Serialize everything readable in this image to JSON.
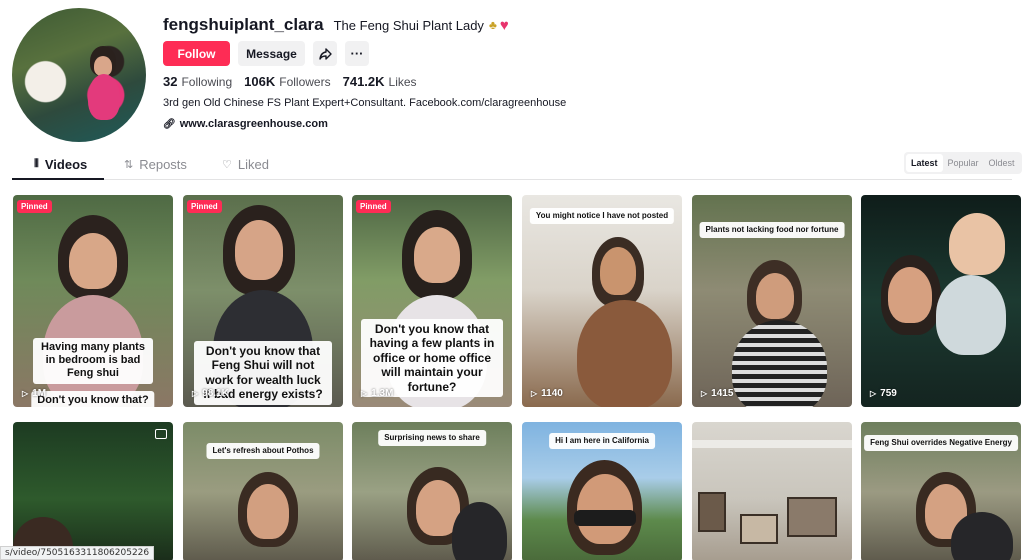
{
  "profile": {
    "username": "fengshuiplant_clara",
    "nickname": "The Feng Shui Plant Lady",
    "follow_label": "Follow",
    "message_label": "Message",
    "following_count": "32",
    "following_label": "Following",
    "followers_count": "106K",
    "followers_label": "Followers",
    "likes_count": "741.2K",
    "likes_label": "Likes",
    "bio": "3rd gen Old Chinese FS Plant Expert+Consultant. Facebook.com/claragreenhouse",
    "link": "www.clarasgreenhouse.com"
  },
  "tabs": {
    "videos": "Videos",
    "reposts": "Reposts",
    "liked": "Liked"
  },
  "sort": {
    "latest": "Latest",
    "popular": "Popular",
    "oldest": "Oldest"
  },
  "videos": [
    {
      "pinned": "Pinned",
      "caption": "Having many plants in bedroom is bad Feng shui",
      "caption2": "Don't you know that?",
      "views": "1M"
    },
    {
      "pinned": "Pinned",
      "caption": "Don't you know that Feng Shui will not work for wealth luck if bad energy exists?",
      "views": "98.1K"
    },
    {
      "pinned": "Pinned",
      "caption": "Don't you know that having a few plants in office or home office will maintain your fortune?",
      "views": "1.3M"
    },
    {
      "caption": "You might notice I have not posted",
      "views": "1140"
    },
    {
      "caption": "Plants not lacking food nor fortune",
      "views": "1415"
    },
    {
      "views": "759"
    },
    {},
    {
      "caption": "Let's refresh about Pothos"
    },
    {
      "caption": "Surprising news to share"
    },
    {
      "caption": "Hi I am here in California"
    },
    {},
    {
      "caption": "Feng Shui overrides Negative Energy"
    }
  ],
  "status_url": "s/video/7505163311806205226",
  "colors": {
    "accent": "#fe2c55",
    "text": "#161823",
    "muted": "#8a8b91"
  }
}
